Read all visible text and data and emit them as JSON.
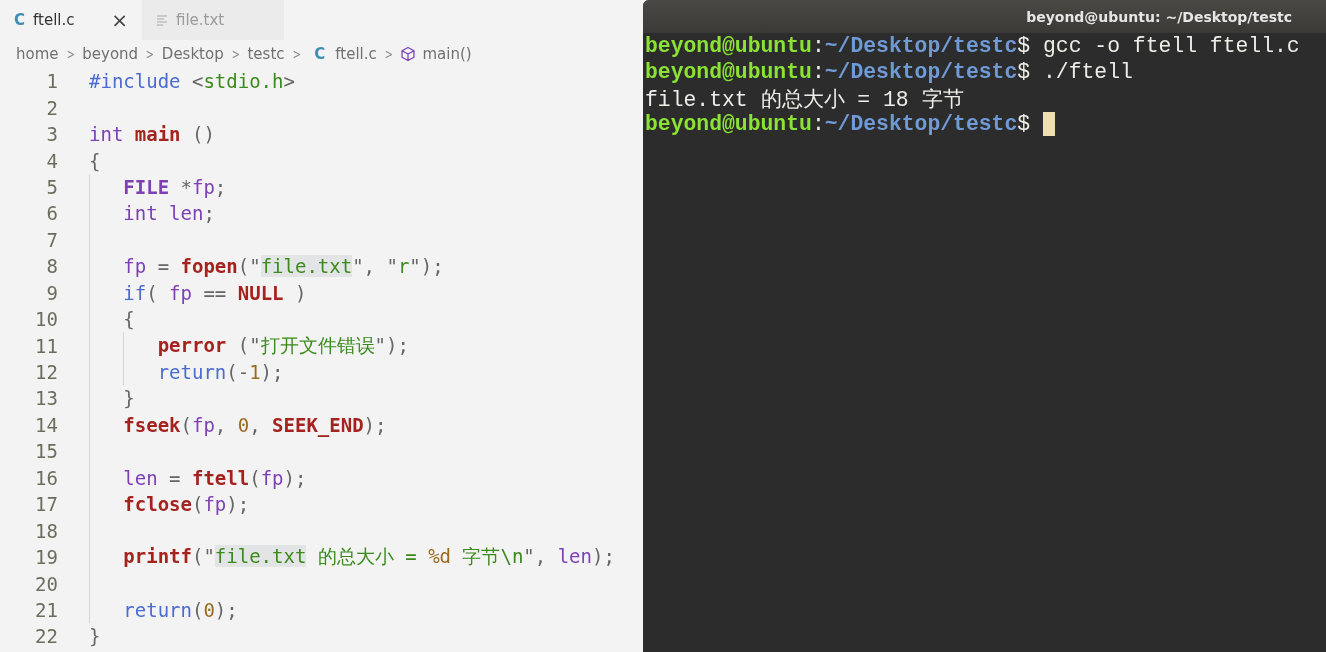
{
  "editor": {
    "tabs": [
      {
        "label": "ftell.c",
        "icon_text": "C",
        "close": "×",
        "selected": true
      },
      {
        "label": "file.txt",
        "selected": false
      }
    ],
    "breadcrumb": [
      {
        "label": "home",
        "kind": "folder"
      },
      {
        "label": "beyond",
        "kind": "folder"
      },
      {
        "label": "Desktop",
        "kind": "folder"
      },
      {
        "label": "testc",
        "kind": "folder"
      },
      {
        "label": "ftell.c",
        "kind": "file",
        "icon_text": "C"
      },
      {
        "label": "main()",
        "kind": "symbol"
      }
    ],
    "separator": ">",
    "lines": [
      {
        "number": "1",
        "tokens": [
          {
            "kind": "ctl",
            "text": "#include"
          },
          {
            "kind": "p",
            "text": " <"
          },
          {
            "kind": "str",
            "text": "stdio.h"
          },
          {
            "kind": "p",
            "text": ">"
          }
        ]
      },
      {
        "number": "2"
      },
      {
        "number": "3",
        "tokens": [
          {
            "kind": "type",
            "text": "int "
          },
          {
            "kind": "fn",
            "text": "main"
          },
          {
            "kind": "p",
            "text": " ()"
          }
        ]
      },
      {
        "number": "4",
        "tokens": [
          {
            "kind": "p",
            "text": "{"
          }
        ],
        "children": [
          {
            "number": "5",
            "tokens": [
              {
                "kind": "typeb",
                "text": "FILE"
              },
              {
                "kind": "p",
                "text": " *"
              },
              {
                "kind": "var",
                "text": "fp"
              },
              {
                "kind": "p",
                "text": ";"
              }
            ]
          },
          {
            "number": "6",
            "tokens": [
              {
                "kind": "type",
                "text": "int "
              },
              {
                "kind": "var",
                "text": "len"
              },
              {
                "kind": "p",
                "text": ";"
              }
            ]
          },
          {
            "number": "7"
          },
          {
            "number": "8",
            "tokens": [
              {
                "kind": "var",
                "text": "fp"
              },
              {
                "kind": "p",
                "text": " = "
              },
              {
                "kind": "fn",
                "text": "fopen"
              },
              {
                "kind": "p",
                "text": "(\""
              },
              {
                "kind": "strhl",
                "text": "file.txt"
              },
              {
                "kind": "p",
                "text": "\", \""
              },
              {
                "kind": "str",
                "text": "r"
              },
              {
                "kind": "p",
                "text": "\");"
              }
            ]
          },
          {
            "number": "9",
            "tokens": [
              {
                "kind": "ctl",
                "text": "if"
              },
              {
                "kind": "p",
                "text": "( "
              },
              {
                "kind": "var",
                "text": "fp"
              },
              {
                "kind": "p",
                "text": " == "
              },
              {
                "kind": "fn",
                "text": "NULL"
              },
              {
                "kind": "p",
                "text": " )"
              }
            ]
          },
          {
            "number": "10",
            "tokens": [
              {
                "kind": "p",
                "text": "{"
              }
            ],
            "children": [
              {
                "number": "11",
                "tokens": [
                  {
                    "kind": "fn",
                    "text": "perror"
                  },
                  {
                    "kind": "p",
                    "text": " (\""
                  },
                  {
                    "kind": "str",
                    "text": "打开文件错误"
                  },
                  {
                    "kind": "p",
                    "text": "\");"
                  }
                ]
              },
              {
                "number": "12",
                "tokens": [
                  {
                    "kind": "ctl",
                    "text": "return"
                  },
                  {
                    "kind": "p",
                    "text": "(-"
                  },
                  {
                    "kind": "num",
                    "text": "1"
                  },
                  {
                    "kind": "p",
                    "text": ");"
                  }
                ]
              }
            ]
          },
          {
            "number": "13",
            "tokens": [
              {
                "kind": "p",
                "text": "}"
              }
            ]
          },
          {
            "number": "14",
            "tokens": [
              {
                "kind": "fn",
                "text": "fseek"
              },
              {
                "kind": "p",
                "text": "("
              },
              {
                "kind": "var",
                "text": "fp"
              },
              {
                "kind": "p",
                "text": ", "
              },
              {
                "kind": "num",
                "text": "0"
              },
              {
                "kind": "p",
                "text": ", "
              },
              {
                "kind": "fn",
                "text": "SEEK_END"
              },
              {
                "kind": "p",
                "text": ");"
              }
            ]
          },
          {
            "number": "15"
          },
          {
            "number": "16",
            "tokens": [
              {
                "kind": "var",
                "text": "len"
              },
              {
                "kind": "p",
                "text": " = "
              },
              {
                "kind": "fn",
                "text": "ftell"
              },
              {
                "kind": "p",
                "text": "("
              },
              {
                "kind": "var",
                "text": "fp"
              },
              {
                "kind": "p",
                "text": ");"
              }
            ]
          },
          {
            "number": "17",
            "tokens": [
              {
                "kind": "fn",
                "text": "fclose"
              },
              {
                "kind": "p",
                "text": "("
              },
              {
                "kind": "var",
                "text": "fp"
              },
              {
                "kind": "p",
                "text": ");"
              }
            ]
          },
          {
            "number": "18"
          },
          {
            "number": "19",
            "tokens": [
              {
                "kind": "fn",
                "text": "printf"
              },
              {
                "kind": "p",
                "text": "(\""
              },
              {
                "kind": "strhl",
                "text": "file.txt"
              },
              {
                "kind": "str",
                "text": " 的总大小 = "
              },
              {
                "kind": "num",
                "text": "%d"
              },
              {
                "kind": "str",
                "text": " 字节\\n"
              },
              {
                "kind": "p",
                "text": "\", "
              },
              {
                "kind": "var",
                "text": "len"
              },
              {
                "kind": "p",
                "text": ");"
              }
            ]
          },
          {
            "number": "20"
          },
          {
            "number": "21",
            "tokens": [
              {
                "kind": "ctl",
                "text": "return"
              },
              {
                "kind": "p",
                "text": "("
              },
              {
                "kind": "num",
                "text": "0"
              },
              {
                "kind": "p",
                "text": ");"
              }
            ]
          }
        ]
      },
      {
        "number": "22",
        "tokens": [
          {
            "kind": "p",
            "text": "}"
          }
        ]
      }
    ]
  },
  "terminal": {
    "title": "beyond@ubuntu: ~/Desktop/testc",
    "lines": [
      {
        "segments": [
          {
            "kind": "user",
            "text": "beyond@ubuntu"
          },
          {
            "kind": "text",
            "text": ":"
          },
          {
            "kind": "path",
            "text": "~/Desktop/testc"
          },
          {
            "kind": "text",
            "text": "$ gcc -o ftell ftell.c"
          }
        ],
        "cursor": false
      },
      {
        "segments": [
          {
            "kind": "user",
            "text": "beyond@ubuntu"
          },
          {
            "kind": "text",
            "text": ":"
          },
          {
            "kind": "path",
            "text": "~/Desktop/testc"
          },
          {
            "kind": "text",
            "text": "$ ./ftell"
          }
        ],
        "cursor": false
      },
      {
        "segments": [
          {
            "kind": "text",
            "text": "file.txt 的总大小 = 18 字节"
          }
        ],
        "cursor": false
      },
      {
        "segments": [
          {
            "kind": "user",
            "text": "beyond@ubuntu"
          },
          {
            "kind": "text",
            "text": ":"
          },
          {
            "kind": "path",
            "text": "~/Desktop/testc"
          },
          {
            "kind": "text",
            "text": "$"
          }
        ],
        "cursor": true
      }
    ]
  }
}
